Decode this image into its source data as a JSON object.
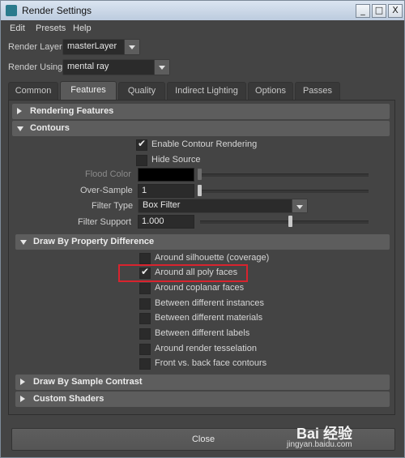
{
  "window": {
    "title": "Render Settings",
    "icons": {
      "app": "maya-app-icon",
      "minimize": "minimize-icon",
      "maximize": "maximize-icon",
      "close": "close-icon"
    },
    "min_glyph": "_",
    "max_glyph": "□",
    "close_glyph": "X"
  },
  "menu": [
    "Edit",
    "Presets",
    "Help"
  ],
  "render_layer": {
    "label": "Render Layer",
    "value": "masterLayer"
  },
  "render_using": {
    "label": "Render Using",
    "value": "mental ray"
  },
  "tabs": [
    "Common",
    "Features",
    "Quality",
    "Indirect Lighting",
    "Options",
    "Passes"
  ],
  "active_tab": "Features",
  "sections": {
    "rendering_features": "Rendering Features",
    "contours": "Contours",
    "draw_by_property": "Draw By Property Difference",
    "draw_by_sample": "Draw By Sample Contrast",
    "custom_shaders": "Custom Shaders"
  },
  "contours": {
    "enable_label": "Enable Contour Rendering",
    "enable_checked": true,
    "hide_source_label": "Hide Source",
    "hide_source_checked": false,
    "flood_color_label": "Flood Color",
    "flood_color": "#000000",
    "over_sample_label": "Over-Sample",
    "over_sample_value": "1",
    "filter_type_label": "Filter Type",
    "filter_type_value": "Box Filter",
    "filter_support_label": "Filter Support",
    "filter_support_value": "1.000"
  },
  "property_difference": [
    {
      "label": "Around silhouette (coverage)",
      "checked": false
    },
    {
      "label": "Around all poly faces",
      "checked": true
    },
    {
      "label": "Around coplanar faces",
      "checked": false
    },
    {
      "label": "Between different instances",
      "checked": false
    },
    {
      "label": "Between different materials",
      "checked": false
    },
    {
      "label": "Between different labels",
      "checked": false
    },
    {
      "label": "Around render tesselation",
      "checked": false
    },
    {
      "label": "Front vs. back face contours",
      "checked": false
    }
  ],
  "close_label": "Close",
  "watermark": {
    "brand": "Bai 经验",
    "url": "jingyan.baidu.com"
  },
  "colors": {
    "highlight": "#d9232e",
    "background": "#444444",
    "header": "#5d5d5d"
  }
}
